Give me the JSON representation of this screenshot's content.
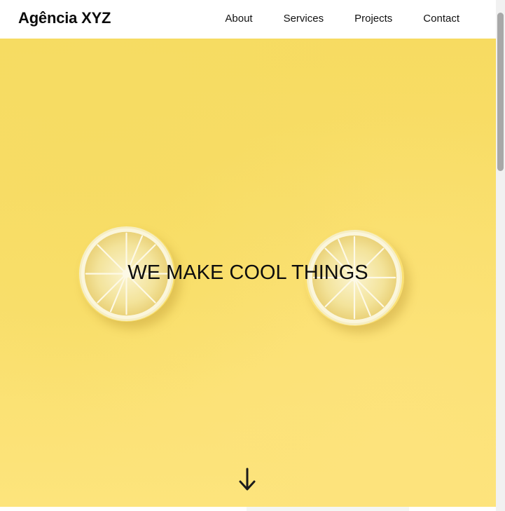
{
  "header": {
    "brand": "Agência XYZ",
    "nav": [
      {
        "label": "About"
      },
      {
        "label": "Services"
      },
      {
        "label": "Projects"
      },
      {
        "label": "Contact"
      }
    ]
  },
  "hero": {
    "headline": "WE MAKE COOL THINGS",
    "background_color": "#f9df6c",
    "image_subject": "lemon-slices-icon",
    "scroll_icon": "arrow-down-icon"
  },
  "colors": {
    "text": "#111111",
    "hero_yellow": "#f9df6c"
  }
}
